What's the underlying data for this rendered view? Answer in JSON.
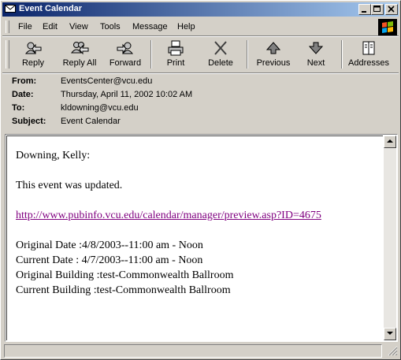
{
  "window": {
    "title": "Event Calendar",
    "icon": "mail-envelope-icon"
  },
  "menu": {
    "items": [
      "File",
      "Edit",
      "View",
      "Tools",
      "Message",
      "Help"
    ]
  },
  "toolbar": {
    "buttons": [
      {
        "label": "Reply",
        "icon": "reply-icon"
      },
      {
        "label": "Reply All",
        "icon": "reply-all-icon"
      },
      {
        "label": "Forward",
        "icon": "forward-icon"
      },
      {
        "label": "Print",
        "icon": "printer-icon"
      },
      {
        "label": "Delete",
        "icon": "delete-x-icon"
      },
      {
        "label": "Previous",
        "icon": "up-arrow-icon"
      },
      {
        "label": "Next",
        "icon": "down-arrow-icon"
      },
      {
        "label": "Addresses",
        "icon": "address-book-icon"
      }
    ]
  },
  "headers": {
    "from_label": "From:",
    "from_value": "EventsCenter@vcu.edu",
    "date_label": "Date:",
    "date_value": "Thursday, April 11, 2002 10:02 AM",
    "to_label": "To:",
    "to_value": "kldowning@vcu.edu",
    "subject_label": "Subject:",
    "subject_value": "Event Calendar"
  },
  "message": {
    "greeting": "Downing, Kelly:",
    "intro": "This event was updated.",
    "link": "http://www.pubinfo.vcu.edu/calendar/manager/preview.asp?ID=4675",
    "original_date": "Original Date :4/8/2003--11:00 am - Noon",
    "current_date": "Current Date : 4/7/2003--11:00 am - Noon",
    "original_building": "Original Building :test-Commonwealth Ballroom",
    "current_building": "Current Building :test-Commonwealth Ballroom"
  },
  "colors": {
    "titlebar_start": "#0a246a",
    "titlebar_end": "#a6caf0",
    "chrome": "#d4d0c8",
    "link_visited": "#800080"
  }
}
